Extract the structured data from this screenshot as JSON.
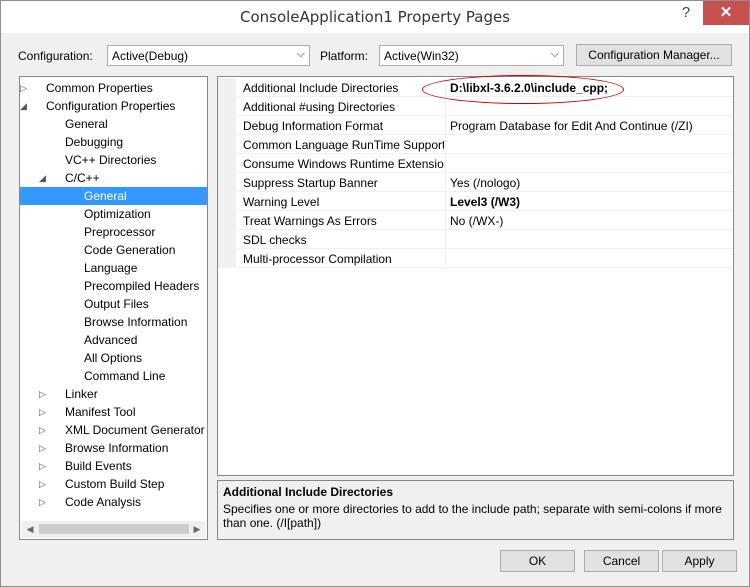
{
  "window": {
    "title": "ConsoleApplication1 Property Pages",
    "help": "?",
    "close": "✕"
  },
  "config": {
    "label": "Configuration:",
    "value": "Active(Debug)"
  },
  "platform": {
    "label": "Platform:",
    "value": "Active(Win32)"
  },
  "config_manager_label": "Configuration Manager...",
  "tree": [
    {
      "label": "Common Properties",
      "expander": "▷",
      "level": 0
    },
    {
      "label": "Configuration Properties",
      "expander": "◢",
      "level": 0
    },
    {
      "label": "General",
      "expander": "",
      "level": 1
    },
    {
      "label": "Debugging",
      "expander": "",
      "level": 1
    },
    {
      "label": "VC++ Directories",
      "expander": "",
      "level": 1
    },
    {
      "label": "C/C++",
      "expander": "◢",
      "level": 1
    },
    {
      "label": "General",
      "expander": "",
      "level": 2,
      "selected": true
    },
    {
      "label": "Optimization",
      "expander": "",
      "level": 2
    },
    {
      "label": "Preprocessor",
      "expander": "",
      "level": 2
    },
    {
      "label": "Code Generation",
      "expander": "",
      "level": 2
    },
    {
      "label": "Language",
      "expander": "",
      "level": 2
    },
    {
      "label": "Precompiled Headers",
      "expander": "",
      "level": 2
    },
    {
      "label": "Output Files",
      "expander": "",
      "level": 2
    },
    {
      "label": "Browse Information",
      "expander": "",
      "level": 2
    },
    {
      "label": "Advanced",
      "expander": "",
      "level": 2
    },
    {
      "label": "All Options",
      "expander": "",
      "level": 2
    },
    {
      "label": "Command Line",
      "expander": "",
      "level": 2
    },
    {
      "label": "Linker",
      "expander": "▷",
      "level": 1
    },
    {
      "label": "Manifest Tool",
      "expander": "▷",
      "level": 1
    },
    {
      "label": "XML Document Generator",
      "expander": "▷",
      "level": 1
    },
    {
      "label": "Browse Information",
      "expander": "▷",
      "level": 1
    },
    {
      "label": "Build Events",
      "expander": "▷",
      "level": 1
    },
    {
      "label": "Custom Build Step",
      "expander": "▷",
      "level": 1
    },
    {
      "label": "Code Analysis",
      "expander": "▷",
      "level": 1
    }
  ],
  "properties": [
    {
      "name": "Additional Include Directories",
      "value": "D:\\libxl-3.6.2.0\\include_cpp;",
      "bold": true
    },
    {
      "name": "Additional #using Directories",
      "value": "",
      "bold": false
    },
    {
      "name": "Debug Information Format",
      "value": "Program Database for Edit And Continue (/ZI)",
      "bold": false
    },
    {
      "name": "Common Language RunTime Support",
      "value": "",
      "bold": false
    },
    {
      "name": "Consume Windows Runtime Extension",
      "value": "",
      "bold": false
    },
    {
      "name": "Suppress Startup Banner",
      "value": "Yes (/nologo)",
      "bold": false
    },
    {
      "name": "Warning Level",
      "value": "Level3 (/W3)",
      "bold": true
    },
    {
      "name": "Treat Warnings As Errors",
      "value": "No (/WX-)",
      "bold": false
    },
    {
      "name": "SDL checks",
      "value": "",
      "bold": false
    },
    {
      "name": "Multi-processor Compilation",
      "value": "",
      "bold": false
    }
  ],
  "description": {
    "title": "Additional Include Directories",
    "text": "Specifies one or more directories to add to the include path; separate with semi-colons if more than one.     (/I[path])"
  },
  "buttons": {
    "ok": "OK",
    "cancel": "Cancel",
    "apply": "Apply"
  }
}
